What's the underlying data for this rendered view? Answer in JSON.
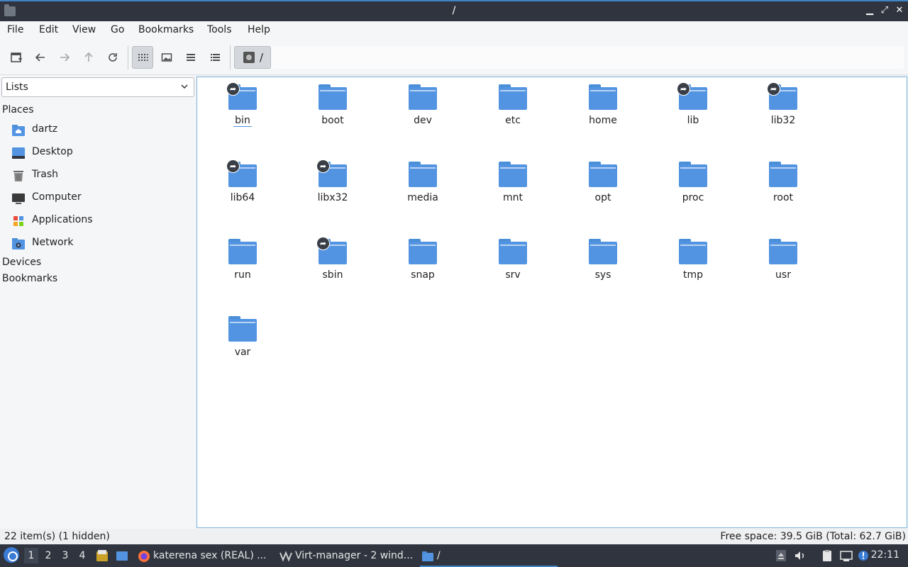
{
  "window": {
    "title": "/"
  },
  "menu": [
    "File",
    "Edit",
    "View",
    "Go",
    "Bookmarks",
    "Tools",
    "Help"
  ],
  "pathbar": {
    "segment": "/"
  },
  "sidebar": {
    "combo_value": "Lists",
    "places_header": "Places",
    "places": [
      {
        "label": "dartz",
        "icon": "home-folder-icon"
      },
      {
        "label": "Desktop",
        "icon": "desktop-icon"
      },
      {
        "label": "Trash",
        "icon": "trash-icon"
      },
      {
        "label": "Computer",
        "icon": "computer-icon"
      },
      {
        "label": "Applications",
        "icon": "applications-icon"
      },
      {
        "label": "Network",
        "icon": "network-icon"
      }
    ],
    "devices_header": "Devices",
    "bookmarks_header": "Bookmarks"
  },
  "files": [
    {
      "name": "bin",
      "link": true,
      "selected": true
    },
    {
      "name": "boot",
      "link": false
    },
    {
      "name": "dev",
      "link": false
    },
    {
      "name": "etc",
      "link": false
    },
    {
      "name": "home",
      "link": false
    },
    {
      "name": "lib",
      "link": true
    },
    {
      "name": "lib32",
      "link": true
    },
    {
      "name": "lib64",
      "link": true
    },
    {
      "name": "libx32",
      "link": true
    },
    {
      "name": "media",
      "link": false
    },
    {
      "name": "mnt",
      "link": false
    },
    {
      "name": "opt",
      "link": false
    },
    {
      "name": "proc",
      "link": false
    },
    {
      "name": "root",
      "link": false
    },
    {
      "name": "run",
      "link": false
    },
    {
      "name": "sbin",
      "link": true
    },
    {
      "name": "snap",
      "link": false
    },
    {
      "name": "srv",
      "link": false
    },
    {
      "name": "sys",
      "link": false
    },
    {
      "name": "tmp",
      "link": false
    },
    {
      "name": "usr",
      "link": false
    },
    {
      "name": "var",
      "link": false
    }
  ],
  "status": {
    "left": "22 item(s) (1 hidden)",
    "right": "Free space: 39.5 GiB (Total: 62.7 GiB)"
  },
  "taskbar": {
    "workspaces": [
      "1",
      "2",
      "3",
      "4"
    ],
    "active_workspace": "1",
    "tasks": [
      {
        "label": "katerena sex (REAL) ...",
        "icon": "firefox-icon"
      },
      {
        "label": "Virt-manager - 2 wind...",
        "icon": "virt-manager-icon"
      },
      {
        "label": "/",
        "icon": "folder-icon"
      }
    ],
    "clock": "22:11"
  },
  "colors": {
    "accent": "#3f84c5",
    "folder": "#5294e2",
    "panel": "#2f343f"
  }
}
